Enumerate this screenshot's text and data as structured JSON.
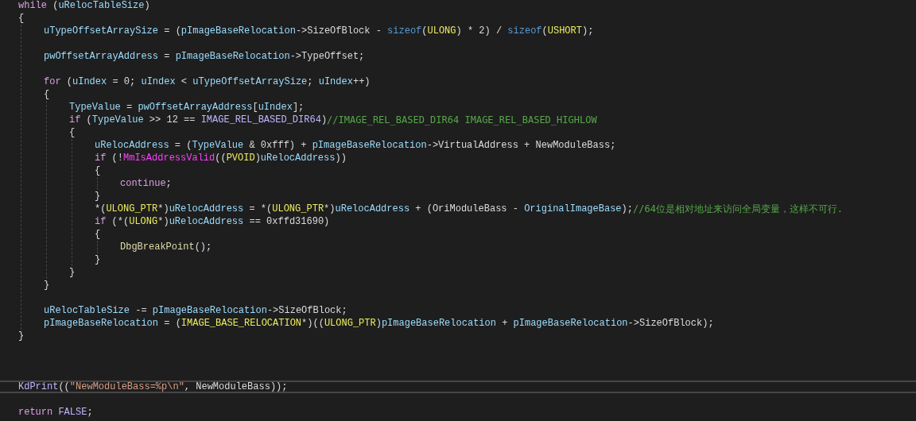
{
  "editor": {
    "lines": [
      {
        "kind": "line",
        "current": false,
        "tokens": [
          {
            "kind": "keyword",
            "text": "while"
          },
          {
            "kind": "text",
            "text": " ("
          },
          {
            "kind": "identifier",
            "text": "uRelocTableSize"
          },
          {
            "kind": "text",
            "text": ")"
          }
        ]
      },
      {
        "kind": "line",
        "current": false,
        "tokens": [
          {
            "kind": "text",
            "text": "{"
          }
        ]
      },
      {
        "kind": "block",
        "children": [
          {
            "kind": "line",
            "current": false,
            "tokens": [
              {
                "kind": "identifier",
                "text": "uTypeOffsetArraySize"
              },
              {
                "kind": "text",
                "text": " = ("
              },
              {
                "kind": "identifier",
                "text": "pImageBaseRelocation"
              },
              {
                "kind": "text",
                "text": "->SizeOfBlock - "
              },
              {
                "kind": "builtin",
                "text": "sizeof"
              },
              {
                "kind": "text",
                "text": "("
              },
              {
                "kind": "type",
                "text": "ULONG"
              },
              {
                "kind": "text",
                "text": ") * 2) / "
              },
              {
                "kind": "builtin",
                "text": "sizeof"
              },
              {
                "kind": "text",
                "text": "("
              },
              {
                "kind": "type",
                "text": "USHORT"
              },
              {
                "kind": "text",
                "text": ");"
              }
            ]
          },
          {
            "kind": "blank"
          },
          {
            "kind": "line",
            "current": false,
            "tokens": [
              {
                "kind": "identifier",
                "text": "pwOffsetArrayAddress"
              },
              {
                "kind": "text",
                "text": " = "
              },
              {
                "kind": "identifier",
                "text": "pImageBaseRelocation"
              },
              {
                "kind": "text",
                "text": "->TypeOffset;"
              }
            ]
          },
          {
            "kind": "blank"
          },
          {
            "kind": "line",
            "current": false,
            "tokens": [
              {
                "kind": "keyword",
                "text": "for"
              },
              {
                "kind": "text",
                "text": " ("
              },
              {
                "kind": "identifier",
                "text": "uIndex"
              },
              {
                "kind": "text",
                "text": " = 0; "
              },
              {
                "kind": "identifier",
                "text": "uIndex"
              },
              {
                "kind": "text",
                "text": " < "
              },
              {
                "kind": "identifier",
                "text": "uTypeOffsetArraySize"
              },
              {
                "kind": "text",
                "text": "; "
              },
              {
                "kind": "identifier",
                "text": "uIndex"
              },
              {
                "kind": "text",
                "text": "++)"
              }
            ]
          },
          {
            "kind": "line",
            "current": false,
            "tokens": [
              {
                "kind": "text",
                "text": "{"
              }
            ]
          },
          {
            "kind": "block",
            "children": [
              {
                "kind": "line",
                "current": false,
                "tokens": [
                  {
                    "kind": "identifier",
                    "text": "TypeValue"
                  },
                  {
                    "kind": "text",
                    "text": " = "
                  },
                  {
                    "kind": "identifier",
                    "text": "pwOffsetArrayAddress"
                  },
                  {
                    "kind": "text",
                    "text": "["
                  },
                  {
                    "kind": "identifier",
                    "text": "uIndex"
                  },
                  {
                    "kind": "text",
                    "text": "];"
                  }
                ]
              },
              {
                "kind": "line",
                "current": false,
                "tokens": [
                  {
                    "kind": "keyword",
                    "text": "if"
                  },
                  {
                    "kind": "text",
                    "text": " ("
                  },
                  {
                    "kind": "identifier",
                    "text": "TypeValue"
                  },
                  {
                    "kind": "text",
                    "text": " >> 12 == "
                  },
                  {
                    "kind": "macro",
                    "text": "IMAGE_REL_BASED_DIR64"
                  },
                  {
                    "kind": "text",
                    "text": ")"
                  },
                  {
                    "kind": "comment",
                    "text": "//IMAGE_REL_BASED_DIR64 IMAGE_REL_BASED_HIGHLOW"
                  }
                ]
              },
              {
                "kind": "line",
                "current": false,
                "tokens": [
                  {
                    "kind": "text",
                    "text": "{"
                  }
                ]
              },
              {
                "kind": "block",
                "children": [
                  {
                    "kind": "line",
                    "current": false,
                    "tokens": [
                      {
                        "kind": "identifier",
                        "text": "uRelocAddress"
                      },
                      {
                        "kind": "text",
                        "text": " = ("
                      },
                      {
                        "kind": "identifier",
                        "text": "TypeValue"
                      },
                      {
                        "kind": "text",
                        "text": " & 0xfff) + "
                      },
                      {
                        "kind": "identifier",
                        "text": "pImageBaseRelocation"
                      },
                      {
                        "kind": "text",
                        "text": "->VirtualAddress + NewModuleBass;"
                      }
                    ]
                  },
                  {
                    "kind": "line",
                    "current": false,
                    "tokens": [
                      {
                        "kind": "keyword",
                        "text": "if"
                      },
                      {
                        "kind": "text",
                        "text": " (!"
                      },
                      {
                        "kind": "import",
                        "text": "MmIsAddressValid"
                      },
                      {
                        "kind": "text",
                        "text": "(("
                      },
                      {
                        "kind": "type",
                        "text": "PVOID"
                      },
                      {
                        "kind": "text",
                        "text": ")"
                      },
                      {
                        "kind": "identifier",
                        "text": "uRelocAddress"
                      },
                      {
                        "kind": "text",
                        "text": "))"
                      }
                    ]
                  },
                  {
                    "kind": "line",
                    "current": false,
                    "tokens": [
                      {
                        "kind": "text",
                        "text": "{"
                      }
                    ]
                  },
                  {
                    "kind": "block",
                    "children": [
                      {
                        "kind": "line",
                        "current": false,
                        "tokens": [
                          {
                            "kind": "keyword",
                            "text": "continue"
                          },
                          {
                            "kind": "text",
                            "text": ";"
                          }
                        ]
                      }
                    ]
                  },
                  {
                    "kind": "line",
                    "current": false,
                    "tokens": [
                      {
                        "kind": "text",
                        "text": "}"
                      }
                    ]
                  },
                  {
                    "kind": "line",
                    "current": false,
                    "tokens": [
                      {
                        "kind": "text",
                        "text": "*("
                      },
                      {
                        "kind": "type",
                        "text": "ULONG_PTR"
                      },
                      {
                        "kind": "text",
                        "text": "*)"
                      },
                      {
                        "kind": "identifier",
                        "text": "uRelocAddress"
                      },
                      {
                        "kind": "text",
                        "text": " = *("
                      },
                      {
                        "kind": "type",
                        "text": "ULONG_PTR"
                      },
                      {
                        "kind": "text",
                        "text": "*)"
                      },
                      {
                        "kind": "identifier",
                        "text": "uRelocAddress"
                      },
                      {
                        "kind": "text",
                        "text": " + (OriModuleBass - "
                      },
                      {
                        "kind": "identifier",
                        "text": "OriginalImageBase"
                      },
                      {
                        "kind": "text",
                        "text": ");"
                      },
                      {
                        "kind": "comment",
                        "text": "//64位是相对地址来访问全局变量，这样不可行."
                      }
                    ]
                  },
                  {
                    "kind": "line",
                    "current": false,
                    "tokens": [
                      {
                        "kind": "keyword",
                        "text": "if"
                      },
                      {
                        "kind": "text",
                        "text": " (*("
                      },
                      {
                        "kind": "type",
                        "text": "ULONG"
                      },
                      {
                        "kind": "text",
                        "text": "*)"
                      },
                      {
                        "kind": "identifier",
                        "text": "uRelocAddress"
                      },
                      {
                        "kind": "text",
                        "text": " == 0xffd31690)"
                      }
                    ]
                  },
                  {
                    "kind": "line",
                    "current": false,
                    "tokens": [
                      {
                        "kind": "text",
                        "text": "{"
                      }
                    ]
                  },
                  {
                    "kind": "block",
                    "children": [
                      {
                        "kind": "line",
                        "current": false,
                        "tokens": [
                          {
                            "kind": "function",
                            "text": "DbgBreakPoint"
                          },
                          {
                            "kind": "text",
                            "text": "();"
                          }
                        ]
                      }
                    ]
                  },
                  {
                    "kind": "line",
                    "current": false,
                    "tokens": [
                      {
                        "kind": "text",
                        "text": "}"
                      }
                    ]
                  }
                ]
              },
              {
                "kind": "line",
                "current": false,
                "tokens": [
                  {
                    "kind": "text",
                    "text": "}"
                  }
                ]
              }
            ]
          },
          {
            "kind": "line",
            "current": false,
            "tokens": [
              {
                "kind": "text",
                "text": "}"
              }
            ]
          },
          {
            "kind": "blank"
          },
          {
            "kind": "line",
            "current": false,
            "tokens": [
              {
                "kind": "identifier",
                "text": "uRelocTableSize"
              },
              {
                "kind": "text",
                "text": " -= "
              },
              {
                "kind": "identifier",
                "text": "pImageBaseRelocation"
              },
              {
                "kind": "text",
                "text": "->SizeOfBlock;"
              }
            ]
          },
          {
            "kind": "line",
            "current": false,
            "tokens": [
              {
                "kind": "identifier",
                "text": "pImageBaseRelocation"
              },
              {
                "kind": "text",
                "text": " = ("
              },
              {
                "kind": "type",
                "text": "IMAGE_BASE_RELOCATION"
              },
              {
                "kind": "text",
                "text": "*)(("
              },
              {
                "kind": "type",
                "text": "ULONG_PTR"
              },
              {
                "kind": "text",
                "text": ")"
              },
              {
                "kind": "identifier",
                "text": "pImageBaseRelocation"
              },
              {
                "kind": "text",
                "text": " + "
              },
              {
                "kind": "identifier",
                "text": "pImageBaseRelocation"
              },
              {
                "kind": "text",
                "text": "->SizeOfBlock);"
              }
            ]
          }
        ]
      },
      {
        "kind": "line",
        "current": false,
        "tokens": [
          {
            "kind": "text",
            "text": "}"
          }
        ]
      },
      {
        "kind": "blank"
      },
      {
        "kind": "blank"
      },
      {
        "kind": "blank"
      },
      {
        "kind": "line",
        "current": true,
        "tokens": [
          {
            "kind": "macro",
            "text": "KdPrint"
          },
          {
            "kind": "text",
            "text": "(("
          },
          {
            "kind": "string",
            "text": "\"NewModuleBass=%p\\n\""
          },
          {
            "kind": "text",
            "text": ", NewModuleBass));"
          }
        ]
      },
      {
        "kind": "blank"
      },
      {
        "kind": "line",
        "current": false,
        "tokens": [
          {
            "kind": "keyword",
            "text": "return "
          },
          {
            "kind": "macro",
            "text": "FALSE"
          },
          {
            "kind": "text",
            "text": ";"
          }
        ]
      }
    ]
  }
}
